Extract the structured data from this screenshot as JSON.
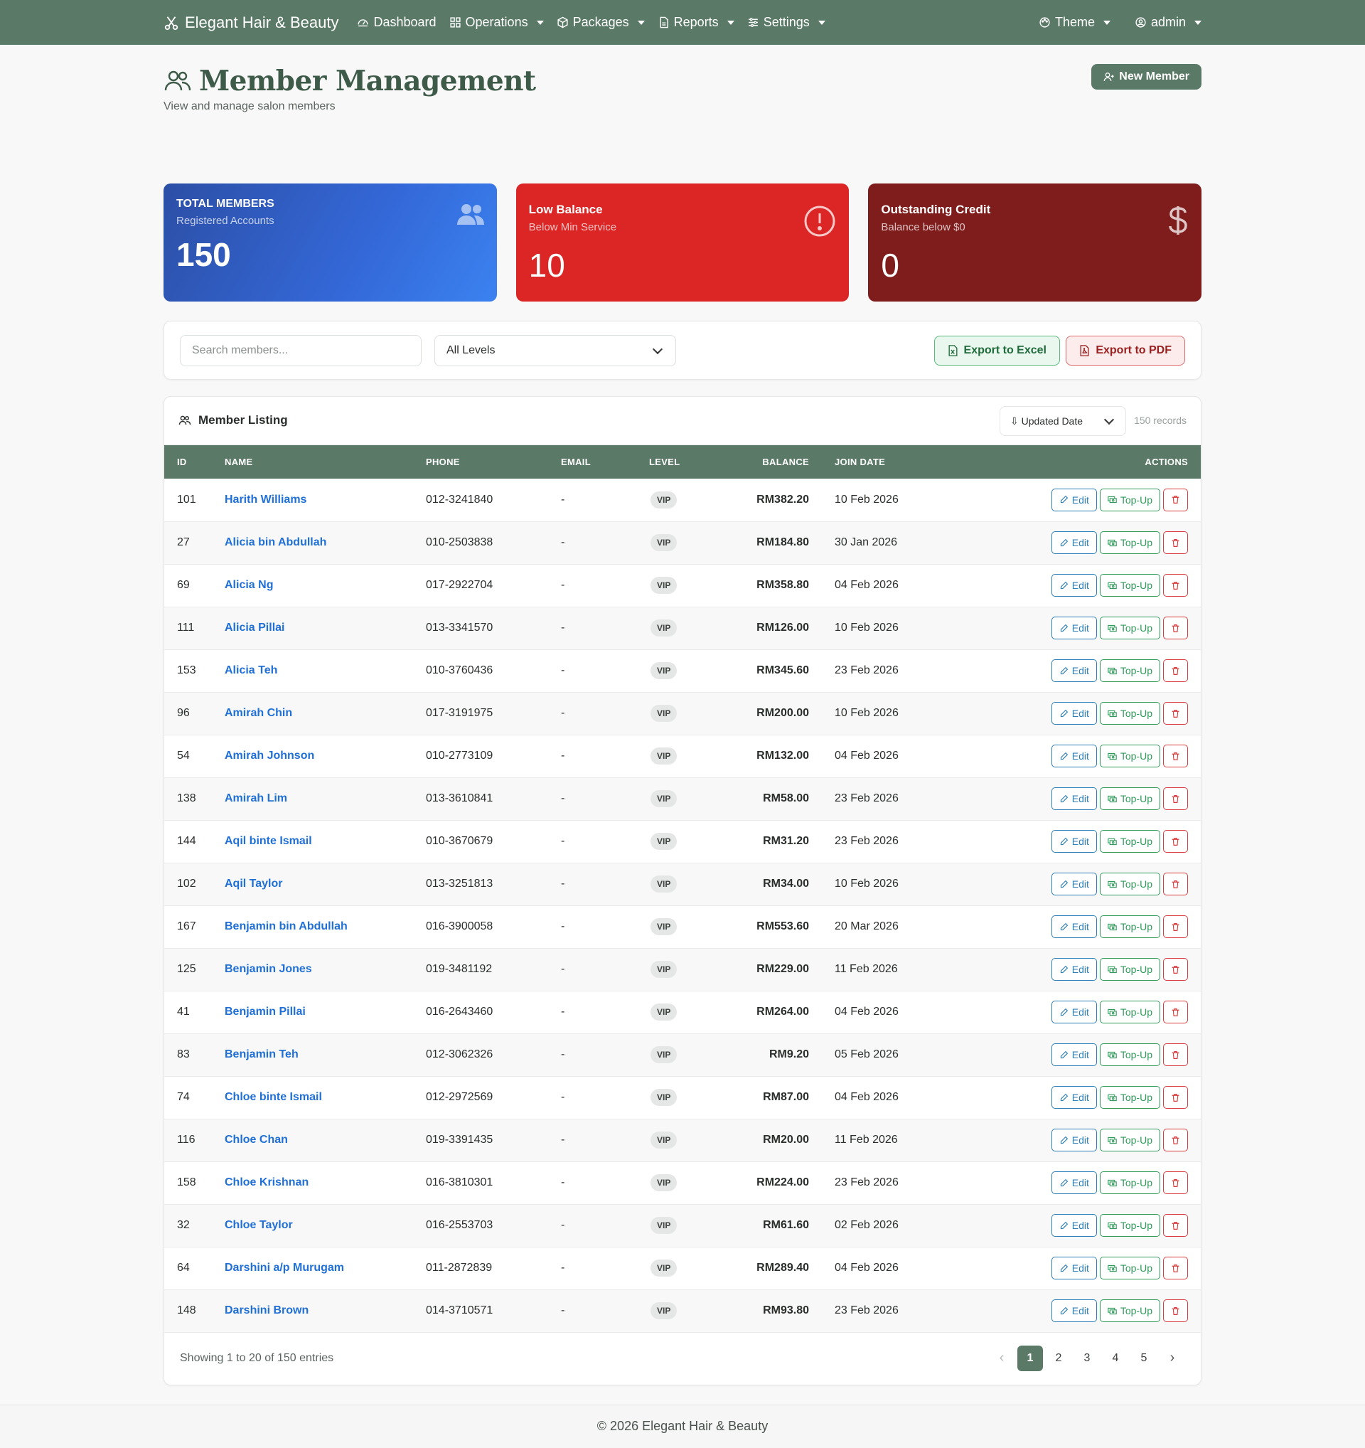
{
  "navbar": {
    "brand": "Elegant Hair & Beauty",
    "items": [
      {
        "label": "Dashboard",
        "icon": "dashboard-icon",
        "dropdown": false
      },
      {
        "label": "Operations",
        "icon": "grid-icon",
        "dropdown": true
      },
      {
        "label": "Packages",
        "icon": "package-icon",
        "dropdown": true
      },
      {
        "label": "Reports",
        "icon": "report-icon",
        "dropdown": true
      },
      {
        "label": "Settings",
        "icon": "sliders-icon",
        "dropdown": true
      }
    ],
    "theme": "Theme",
    "user": "admin"
  },
  "page": {
    "title": "Member Management",
    "subtitle": "View and manage salon members",
    "new_button": "New Member"
  },
  "stats": [
    {
      "title": "TOTAL MEMBERS",
      "subtitle": "Registered Accounts",
      "value": "150",
      "icon": "people-icon",
      "color": "#2f5fc4"
    },
    {
      "title": "Low Balance",
      "subtitle": "Below Min Service",
      "value": "10",
      "icon": "alert-circle-icon",
      "color": "#dc2626"
    },
    {
      "title": "Outstanding Credit",
      "subtitle": "Balance below $0",
      "value": "0",
      "icon": "dollar-icon",
      "color": "#7f1d1d"
    }
  ],
  "filters": {
    "search_placeholder": "Search members...",
    "level": "All Levels",
    "export_excel": "Export to Excel",
    "export_pdf": "Export to PDF"
  },
  "listing": {
    "title": "Member Listing",
    "sort": "Updated Date",
    "records": "150 records",
    "columns": [
      "ID",
      "NAME",
      "PHONE",
      "EMAIL",
      "LEVEL",
      "BALANCE",
      "JOIN DATE",
      "ACTIONS"
    ],
    "rows": [
      {
        "id": "101",
        "name": "Harith Williams",
        "phone": "012-3241840",
        "email": "-",
        "level": "VIP",
        "balance": "RM382.20",
        "join": "10 Feb 2026"
      },
      {
        "id": "27",
        "name": "Alicia bin Abdullah",
        "phone": "010-2503838",
        "email": "-",
        "level": "VIP",
        "balance": "RM184.80",
        "join": "30 Jan 2026"
      },
      {
        "id": "69",
        "name": "Alicia Ng",
        "phone": "017-2922704",
        "email": "-",
        "level": "VIP",
        "balance": "RM358.80",
        "join": "04 Feb 2026"
      },
      {
        "id": "111",
        "name": "Alicia Pillai",
        "phone": "013-3341570",
        "email": "-",
        "level": "VIP",
        "balance": "RM126.00",
        "join": "10 Feb 2026"
      },
      {
        "id": "153",
        "name": "Alicia Teh",
        "phone": "010-3760436",
        "email": "-",
        "level": "VIP",
        "balance": "RM345.60",
        "join": "23 Feb 2026"
      },
      {
        "id": "96",
        "name": "Amirah Chin",
        "phone": "017-3191975",
        "email": "-",
        "level": "VIP",
        "balance": "RM200.00",
        "join": "10 Feb 2026"
      },
      {
        "id": "54",
        "name": "Amirah Johnson",
        "phone": "010-2773109",
        "email": "-",
        "level": "VIP",
        "balance": "RM132.00",
        "join": "04 Feb 2026"
      },
      {
        "id": "138",
        "name": "Amirah Lim",
        "phone": "013-3610841",
        "email": "-",
        "level": "VIP",
        "balance": "RM58.00",
        "join": "23 Feb 2026"
      },
      {
        "id": "144",
        "name": "Aqil binte Ismail",
        "phone": "010-3670679",
        "email": "-",
        "level": "VIP",
        "balance": "RM31.20",
        "join": "23 Feb 2026"
      },
      {
        "id": "102",
        "name": "Aqil Taylor",
        "phone": "013-3251813",
        "email": "-",
        "level": "VIP",
        "balance": "RM34.00",
        "join": "10 Feb 2026"
      },
      {
        "id": "167",
        "name": "Benjamin bin Abdullah",
        "phone": "016-3900058",
        "email": "-",
        "level": "VIP",
        "balance": "RM553.60",
        "join": "20 Mar 2026"
      },
      {
        "id": "125",
        "name": "Benjamin Jones",
        "phone": "019-3481192",
        "email": "-",
        "level": "VIP",
        "balance": "RM229.00",
        "join": "11 Feb 2026"
      },
      {
        "id": "41",
        "name": "Benjamin Pillai",
        "phone": "016-2643460",
        "email": "-",
        "level": "VIP",
        "balance": "RM264.00",
        "join": "04 Feb 2026"
      },
      {
        "id": "83",
        "name": "Benjamin Teh",
        "phone": "012-3062326",
        "email": "-",
        "level": "VIP",
        "balance": "RM9.20",
        "join": "05 Feb 2026"
      },
      {
        "id": "74",
        "name": "Chloe binte Ismail",
        "phone": "012-2972569",
        "email": "-",
        "level": "VIP",
        "balance": "RM87.00",
        "join": "04 Feb 2026"
      },
      {
        "id": "116",
        "name": "Chloe Chan",
        "phone": "019-3391435",
        "email": "-",
        "level": "VIP",
        "balance": "RM20.00",
        "join": "11 Feb 2026"
      },
      {
        "id": "158",
        "name": "Chloe Krishnan",
        "phone": "016-3810301",
        "email": "-",
        "level": "VIP",
        "balance": "RM224.00",
        "join": "23 Feb 2026"
      },
      {
        "id": "32",
        "name": "Chloe Taylor",
        "phone": "016-2553703",
        "email": "-",
        "level": "VIP",
        "balance": "RM61.60",
        "join": "02 Feb 2026"
      },
      {
        "id": "64",
        "name": "Darshini a/p Murugam",
        "phone": "011-2872839",
        "email": "-",
        "level": "VIP",
        "balance": "RM289.40",
        "join": "04 Feb 2026"
      },
      {
        "id": "148",
        "name": "Darshini Brown",
        "phone": "014-3710571",
        "email": "-",
        "level": "VIP",
        "balance": "RM93.80",
        "join": "23 Feb 2026"
      }
    ],
    "action_labels": {
      "edit": "Edit",
      "topup": "Top-Up"
    },
    "showing": "Showing 1 to 20 of 150 entries",
    "pages": [
      "1",
      "2",
      "3",
      "4",
      "5"
    ],
    "active_page": "1"
  },
  "footer": "© 2026 Elegant Hair & Beauty"
}
